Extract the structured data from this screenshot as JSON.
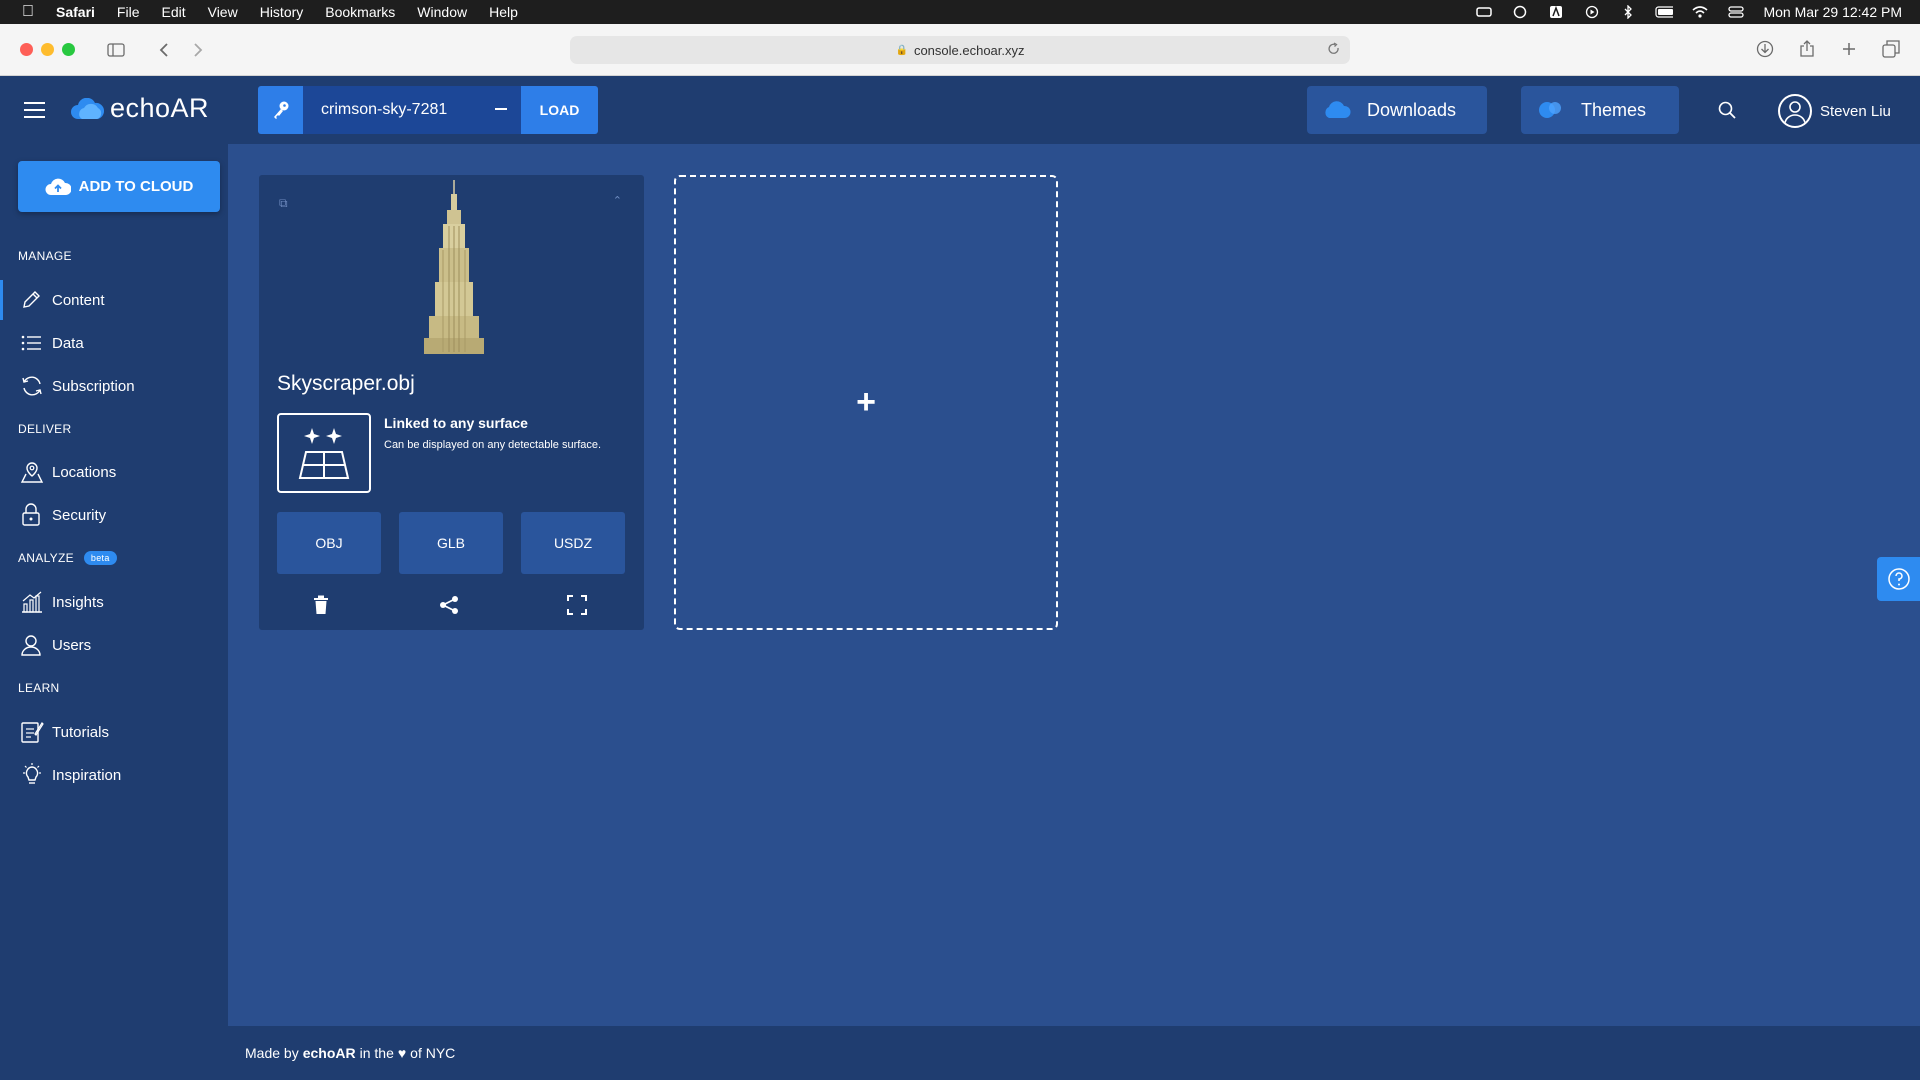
{
  "menubar": {
    "app": "Safari",
    "items": [
      "File",
      "Edit",
      "View",
      "History",
      "Bookmarks",
      "Window",
      "Help"
    ],
    "datetime": "Mon Mar 29  12:42 PM"
  },
  "browser": {
    "url": "console.echoar.xyz"
  },
  "header": {
    "logo": "echoAR",
    "api_key": "crimson-sky-7281",
    "load_label": "LOAD",
    "downloads_label": "Downloads",
    "themes_label": "Themes",
    "user_name": "Steven Liu"
  },
  "sidebar": {
    "add_cloud_label": "ADD TO CLOUD",
    "sections": {
      "manage": "MANAGE",
      "deliver": "DELIVER",
      "analyze": "ANALYZE",
      "analyze_badge": "beta",
      "learn": "LEARN"
    },
    "items": {
      "content": "Content",
      "data": "Data",
      "subscription": "Subscription",
      "locations": "Locations",
      "security": "Security",
      "insights": "Insights",
      "users": "Users",
      "tutorials": "Tutorials",
      "inspiration": "Inspiration"
    },
    "active_item": "Content"
  },
  "card": {
    "title": "Skyscraper.obj",
    "surface_title": "Linked to any surface",
    "surface_desc": "Can be displayed on any detectable surface.",
    "formats": [
      "OBJ",
      "GLB",
      "USDZ"
    ]
  },
  "add_slot": {
    "symbol": "+"
  },
  "footer": {
    "made_by": "Made by",
    "brand": "echoAR",
    "in_the": "in the",
    "heart": "♥",
    "of_nyc": "of NYC"
  },
  "colors": {
    "background": "#2b4f8e",
    "panel": "#1f3d70",
    "accent": "#2e8bf0",
    "button": "#2a559c"
  }
}
